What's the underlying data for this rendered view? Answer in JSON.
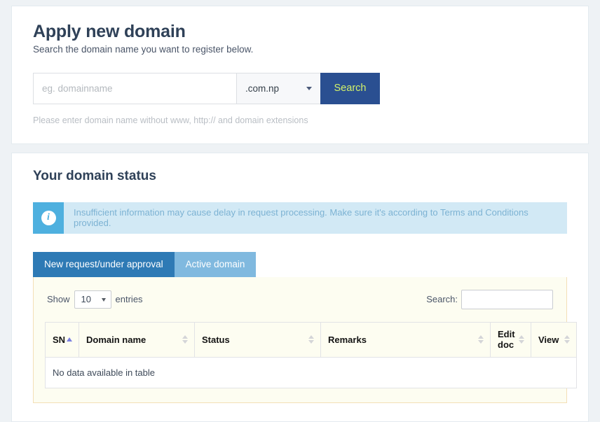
{
  "apply": {
    "title": "Apply new domain",
    "subtitle": "Search the domain name you want to register below.",
    "input_placeholder": "eg. domainname",
    "tld_selected": ".com.np",
    "search_button": "Search",
    "hint": "Please enter domain name without www, http:// and domain extensions"
  },
  "status": {
    "title": "Your domain status",
    "alert": {
      "icon": "info-icon",
      "message": "Insufficient information may cause delay in request processing. Make sure it's according to Terms and Conditions provided."
    },
    "tabs": [
      {
        "label": "New request/under approval",
        "active": true
      },
      {
        "label": "Active domain",
        "active": false
      }
    ],
    "table": {
      "show_label": "Show",
      "entries_label": "entries",
      "page_length": "10",
      "search_label": "Search:",
      "search_value": "",
      "columns": [
        {
          "label": "SN",
          "sorted": "asc"
        },
        {
          "label": "Domain name",
          "sorted": "none"
        },
        {
          "label": "Status",
          "sorted": "none"
        },
        {
          "label": "Remarks",
          "sorted": "none"
        },
        {
          "label": "Edit doc",
          "sorted": "none"
        },
        {
          "label": "View",
          "sorted": "none"
        }
      ],
      "empty_message": "No data available in table"
    }
  },
  "colors": {
    "page_bg": "#eef2f5",
    "heading": "#2f4158",
    "search_button_bg": "#2a4f91",
    "search_button_text": "#d3f26a",
    "alert_bg": "#d2e9f5",
    "alert_icon_bg": "#4eb0df",
    "alert_text": "#7cb2d3",
    "tab_active": "#2e7ab5",
    "tab_inactive": "#80b9df",
    "table_panel_bg": "#fdfdf1",
    "table_panel_border": "#f3dfb6",
    "sort_active": "#7a7fe0"
  }
}
